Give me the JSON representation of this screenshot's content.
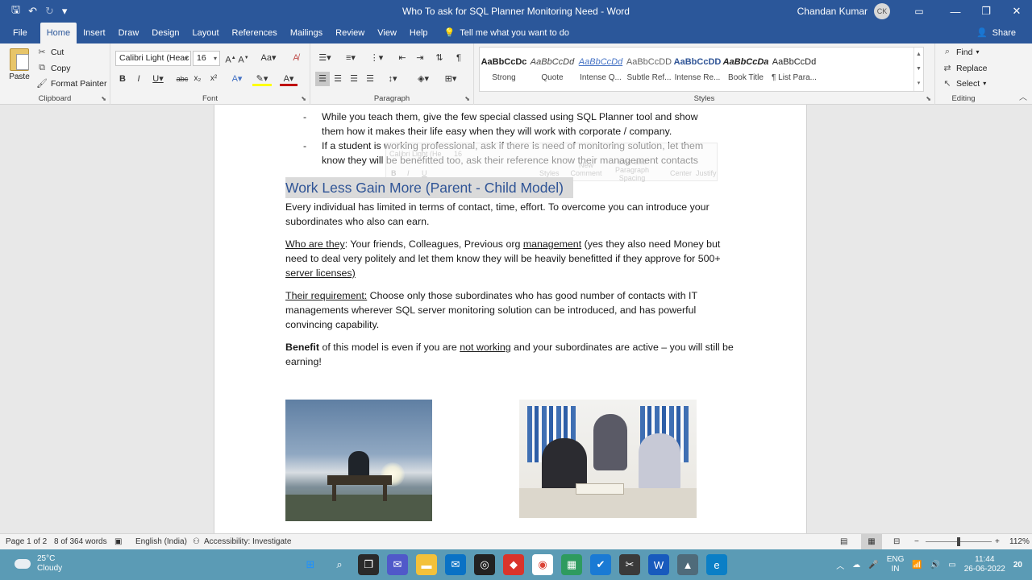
{
  "window": {
    "title": "Who To ask for SQL Planner Monitoring Need  -  Word",
    "user_name": "Chandan Kumar",
    "user_initials": "CK"
  },
  "qat": {
    "save": "🖫",
    "undo": "↶",
    "redo": "↻",
    "customize": "▾"
  },
  "tabs": [
    "File",
    "Home",
    "Insert",
    "Draw",
    "Design",
    "Layout",
    "References",
    "Mailings",
    "Review",
    "View",
    "Help"
  ],
  "tell_me": "Tell me what you want to do",
  "share": "Share",
  "ribbon": {
    "clipboard": {
      "paste": "Paste",
      "cut": "Cut",
      "copy": "Copy",
      "format_painter": "Format Painter",
      "label": "Clipboard"
    },
    "font": {
      "name": "Calibri Light (Heac",
      "size": "16",
      "label": "Font"
    },
    "paragraph": {
      "label": "Paragraph"
    },
    "styles": {
      "label": "Styles",
      "items": [
        {
          "preview": "AaBbCcDc",
          "name": "Strong"
        },
        {
          "preview": "AaBbCcDd",
          "name": "Quote"
        },
        {
          "preview": "AaBbCcDd",
          "name": "Intense Q..."
        },
        {
          "preview": "AaBbCcDD",
          "name": "Subtle Ref..."
        },
        {
          "preview": "AaBbCcDD",
          "name": "Intense Re..."
        },
        {
          "preview": "AaBbCcDa",
          "name": "Book Title"
        },
        {
          "preview": "AaBbCcDd",
          "name": "¶ List Para..."
        }
      ]
    },
    "editing": {
      "find": "Find",
      "replace": "Replace",
      "select": "Select",
      "label": "Editing"
    }
  },
  "document": {
    "bullet1": "While you teach them, give the few special classed using SQL Planner tool and show them how it makes their life easy when they will work with corporate / company.",
    "bullet2": "If a student is working professional, ask if there is need of monitoring solution, let them know they will be benefitted too, ask their reference know their management contacts",
    "heading": "Work Less Gain More (Parent - Child Model)",
    "para1": "Every individual has limited in terms of contact, time, effort. To overcome you can introduce your subordinates who also can earn.",
    "para2_label": "Who are they",
    "para2_a": ": Your friends, Colleagues, Previous org ",
    "para2_mgmt": "management",
    "para2_b": " (yes they also need Money but need to deal very politely and let them know they will be heavily benefitted if they approve for 500+ ",
    "para2_c": "server licenses)",
    "para3_label": "Their requirement:",
    "para3": " Choose only those subordinates who has good number of contacts with IT managements wherever SQL server monitoring solution can be introduced, and has powerful convincing capability.",
    "para4_bold": "Benefit",
    "para4_a": " of this model is even if you are ",
    "para4_u": "not working",
    "para4_b": " and your subordinates are active – you will still be earning!"
  },
  "minitoolbar": {
    "font": "Calibri Light (He",
    "size": "16",
    "styles": "Styles",
    "new_comment": "New Comment",
    "spacing": "Line and Paragraph Spacing",
    "center": "Center",
    "justify": "Justify"
  },
  "status": {
    "page": "Page 1 of 2",
    "words": "8 of 364 words",
    "language": "English (India)",
    "accessibility": "Accessibility: Investigate",
    "zoom": "112%"
  },
  "taskbar": {
    "temperature": "25°C",
    "weather": "Cloudy",
    "lang1": "ENG",
    "lang2": "IN",
    "time": "11:44",
    "date": "26-06-2022",
    "notifications": "20"
  },
  "colors": {
    "word_blue": "#2b579a",
    "heading_blue": "#2f5496",
    "taskbar": "#5b9bb5"
  }
}
